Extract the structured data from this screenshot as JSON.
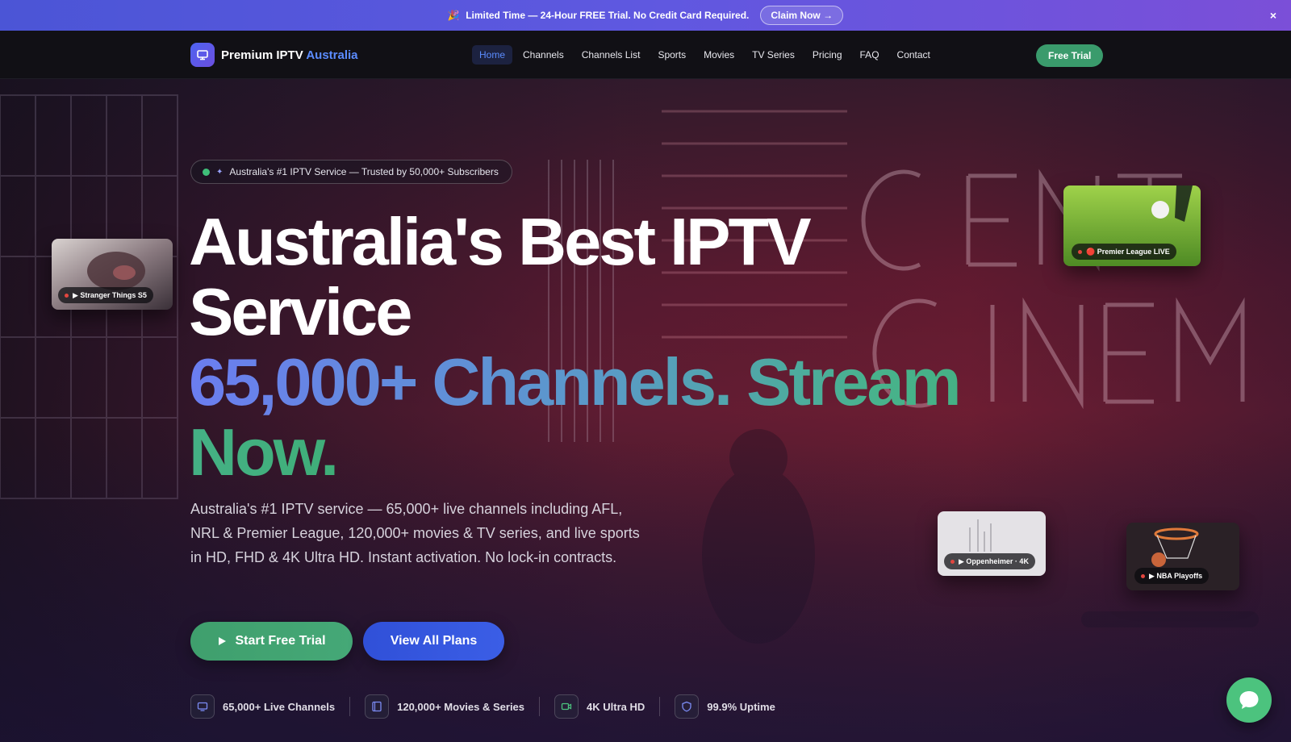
{
  "promo": {
    "emoji": "🎉",
    "text": "Limited Time — 24-Hour FREE Trial. No Credit Card Required.",
    "cta": "Claim Now →",
    "close": "×"
  },
  "nav": {
    "brand_main": "Premium IPTV",
    "brand_accent": "Australia",
    "links": [
      "Home",
      "Channels",
      "Channels List",
      "Sports",
      "Movies",
      "TV Series",
      "Pricing",
      "FAQ",
      "Contact"
    ],
    "active": "Home",
    "cta": "Free Trial"
  },
  "hero": {
    "badge": "Australia's #1 IPTV Service — Trusted by 50,000+ Subscribers",
    "headline_line1": "Australia's Best IPTV",
    "headline_line2": "Service",
    "headline_gradient": "65,000+ Channels. Stream Now.",
    "description": "Australia's #1 IPTV service — 65,000+ live channels including AFL, NRL & Premier League, 120,000+ movies & TV series, and live sports in HD, FHD & 4K Ultra HD. Instant activation. No lock-in contracts.",
    "primary_cta": "Start Free Trial",
    "secondary_cta": "View All Plans",
    "features": [
      {
        "icon": "tv-icon",
        "label": "65,000+ Live Channels"
      },
      {
        "icon": "film-icon",
        "label": "120,000+ Movies & Series"
      },
      {
        "icon": "video-camera-icon",
        "label": "4K Ultra HD"
      },
      {
        "icon": "shield-icon",
        "label": "99.9% Uptime"
      }
    ]
  },
  "cards": {
    "stranger": "▶ Stranger Things S5",
    "premier": "🔴 Premier League LIVE",
    "oppenheimer": "▶ Oppenheimer · 4K",
    "nba": "▶ NBA Playoffs"
  },
  "colors": {
    "accent_blue": "#5b8cff",
    "accent_green": "#3f9f6d",
    "promo_start": "#4b55d6",
    "promo_end": "#7b4fd8"
  }
}
